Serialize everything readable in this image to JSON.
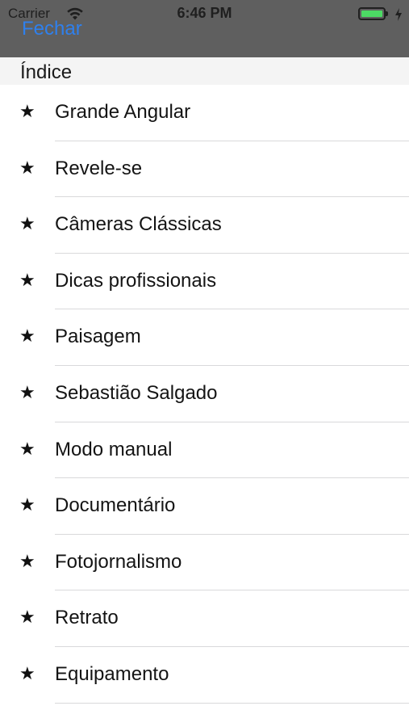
{
  "status_bar": {
    "carrier": "Carrier",
    "time": "6:46 PM",
    "wifi_icon": "wifi-icon",
    "battery_icon": "battery-icon",
    "charging_icon": "charging-bolt-icon",
    "battery_level": 1.0
  },
  "nav": {
    "close_label": "Fechar",
    "close_color": "#2f80ed",
    "bar_color": "#5f5f5f"
  },
  "section": {
    "title": "Índice"
  },
  "items": [
    {
      "label": "Grande Angular",
      "icon": "star-icon"
    },
    {
      "label": "Revele-se",
      "icon": "star-icon"
    },
    {
      "label": "Câmeras Clássicas",
      "icon": "star-icon"
    },
    {
      "label": "Dicas profissionais",
      "icon": "star-icon"
    },
    {
      "label": "Paisagem",
      "icon": "star-icon"
    },
    {
      "label": "Sebastião Salgado",
      "icon": "star-icon"
    },
    {
      "label": "Modo manual",
      "icon": "star-icon"
    },
    {
      "label": "Documentário",
      "icon": "star-icon"
    },
    {
      "label": "Fotojornalismo",
      "icon": "star-icon"
    },
    {
      "label": "Retrato",
      "icon": "star-icon"
    },
    {
      "label": "Equipamento",
      "icon": "star-icon"
    }
  ]
}
